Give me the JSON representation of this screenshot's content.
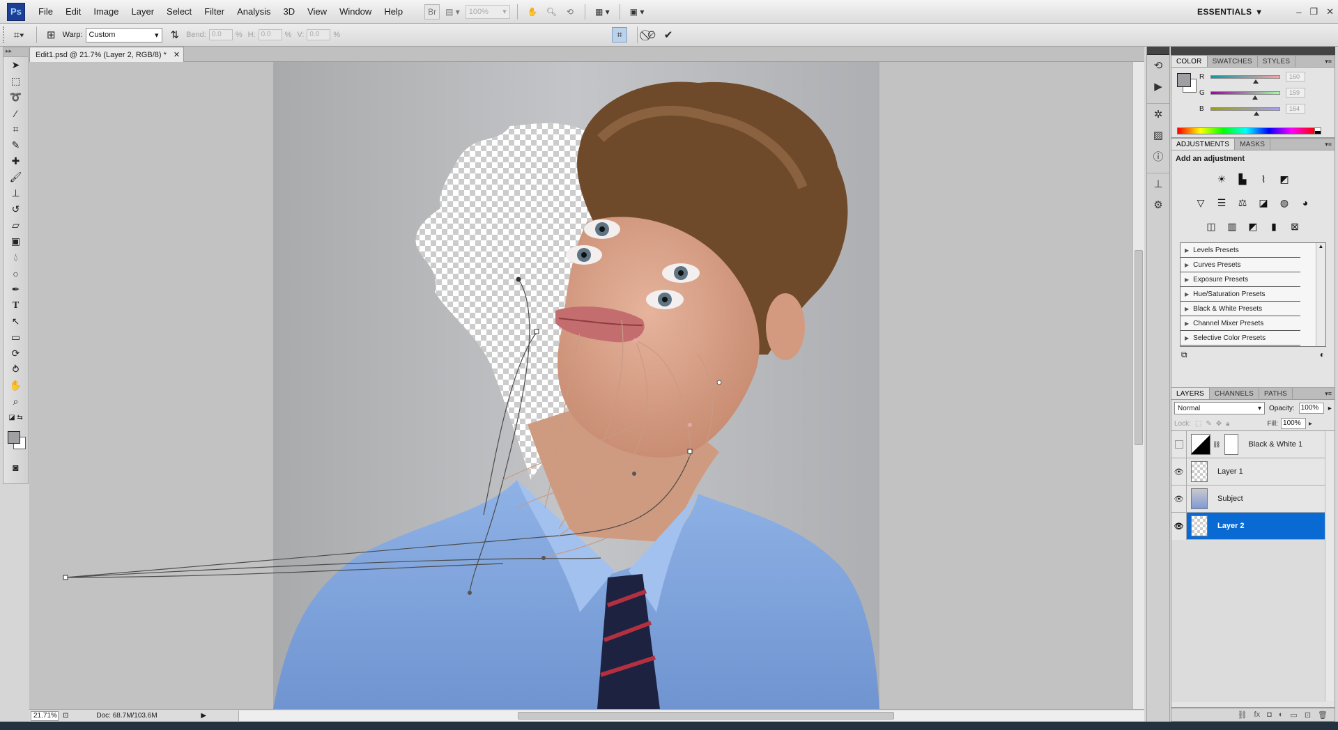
{
  "app": {
    "logo": "Ps"
  },
  "menu": [
    "File",
    "Edit",
    "Image",
    "Layer",
    "Select",
    "Filter",
    "Analysis",
    "3D",
    "View",
    "Window",
    "Help"
  ],
  "appbar": {
    "zoom": "100%"
  },
  "workspace": {
    "label": "ESSENTIALS"
  },
  "options": {
    "warp_label": "Warp:",
    "warp_value": "Custom",
    "bend_label": "Bend:",
    "bend_value": "0.0",
    "h_label": "H:",
    "h_value": "0.0",
    "v_label": "V:",
    "v_value": "0.0",
    "percent": "%"
  },
  "document": {
    "tab_title": "Edit1.psd @ 21.7% (Layer 2, RGB/8) *",
    "zoom": "21.71%",
    "doc_size": "Doc: 68.7M/103.6M"
  },
  "color_panel": {
    "tabs": [
      "COLOR",
      "SWATCHES",
      "STYLES"
    ],
    "r_label": "R",
    "r_value": "160",
    "g_label": "G",
    "g_value": "159",
    "b_label": "B",
    "b_value": "164",
    "foreground": "#a0a0a4"
  },
  "adjustments_panel": {
    "tabs": [
      "ADJUSTMENTS",
      "MASKS"
    ],
    "title": "Add an adjustment",
    "presets": [
      "Levels Presets",
      "Curves Presets",
      "Exposure Presets",
      "Hue/Saturation Presets",
      "Black & White Presets",
      "Channel Mixer Presets",
      "Selective Color Presets"
    ]
  },
  "layers_panel": {
    "tabs": [
      "LAYERS",
      "CHANNELS",
      "PATHS"
    ],
    "blend_mode": "Normal",
    "opacity_label": "Opacity:",
    "opacity_value": "100%",
    "lock_label": "Lock:",
    "fill_label": "Fill:",
    "fill_value": "100%",
    "layers": [
      {
        "name": "Black & White 1",
        "visible": false,
        "selected": false
      },
      {
        "name": "Layer 1",
        "visible": true,
        "selected": false
      },
      {
        "name": "Subject",
        "visible": true,
        "selected": false
      },
      {
        "name": "Layer 2",
        "visible": true,
        "selected": true
      }
    ]
  }
}
